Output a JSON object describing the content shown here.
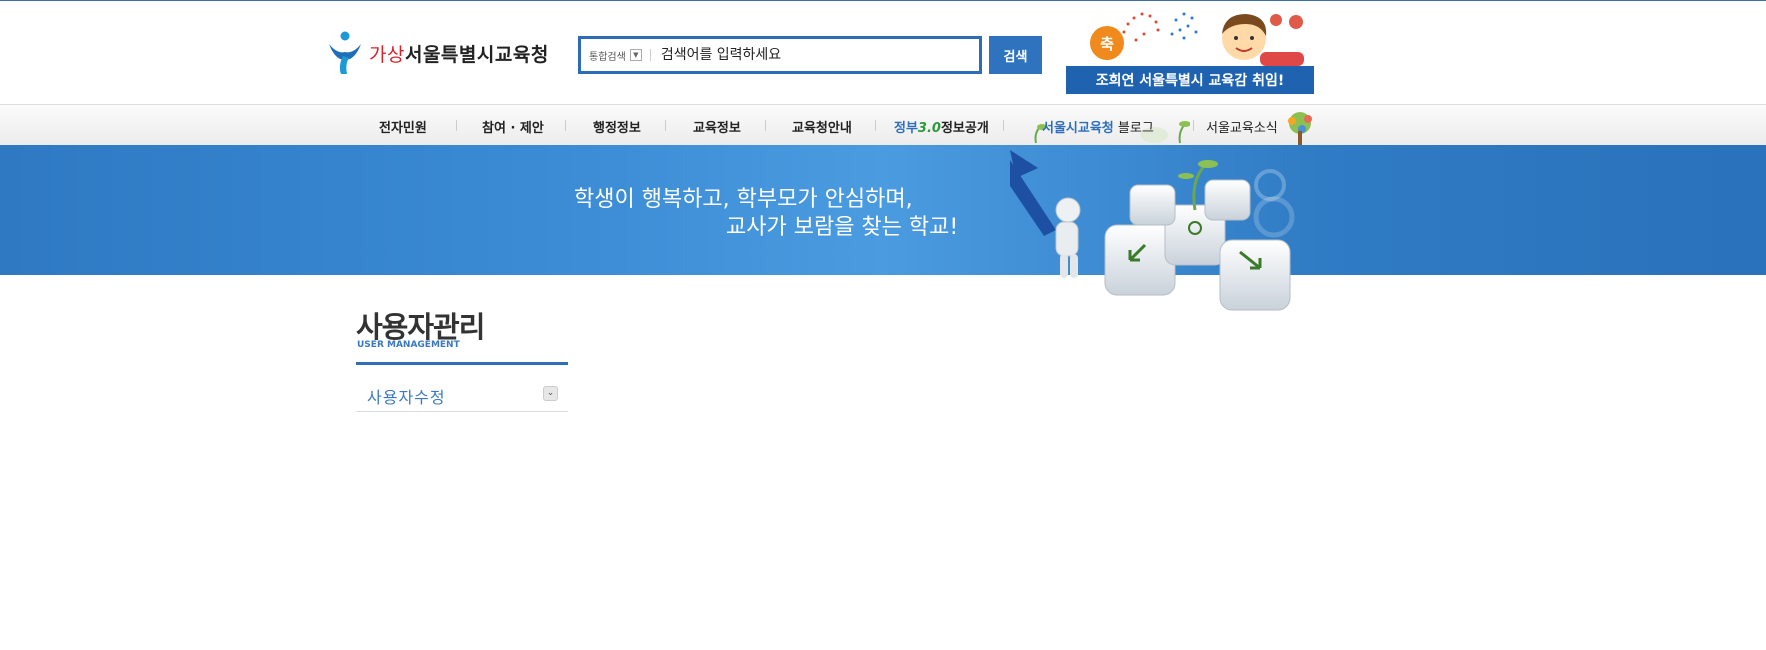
{
  "header": {
    "logo_accent": "가상",
    "logo_text": "서울특별시교육청",
    "search_category": "통합검색",
    "search_placeholder": "검색어를 입력하세요",
    "search_button": "검색",
    "congrats_badge": "축",
    "congrats_text": "조희연 서울특별시 교육감 취임!"
  },
  "nav": {
    "items": [
      "전자민원",
      "참여 · 제안",
      "행정정보",
      "교육정보",
      "교육청안내"
    ],
    "gov_prefix": "정부",
    "gov_version": "3.0",
    "gov_suffix": "정보공개",
    "blog_prefix": "서울시교육청",
    "blog_suffix": "블로그",
    "news": "서울교육소식"
  },
  "banner": {
    "line1": "학생이 행복하고, 학부모가 안심하며,",
    "line2": "교사가 보람을 찾는 학교!"
  },
  "sidebar": {
    "title": "사용자관리",
    "subtitle": "USER MANAGEMENT",
    "items": [
      {
        "label": "사용자수정"
      }
    ]
  },
  "colors": {
    "brand_blue": "#2f6fba",
    "accent_red": "#d8232a",
    "banner_blue": "#3a8ad4"
  }
}
